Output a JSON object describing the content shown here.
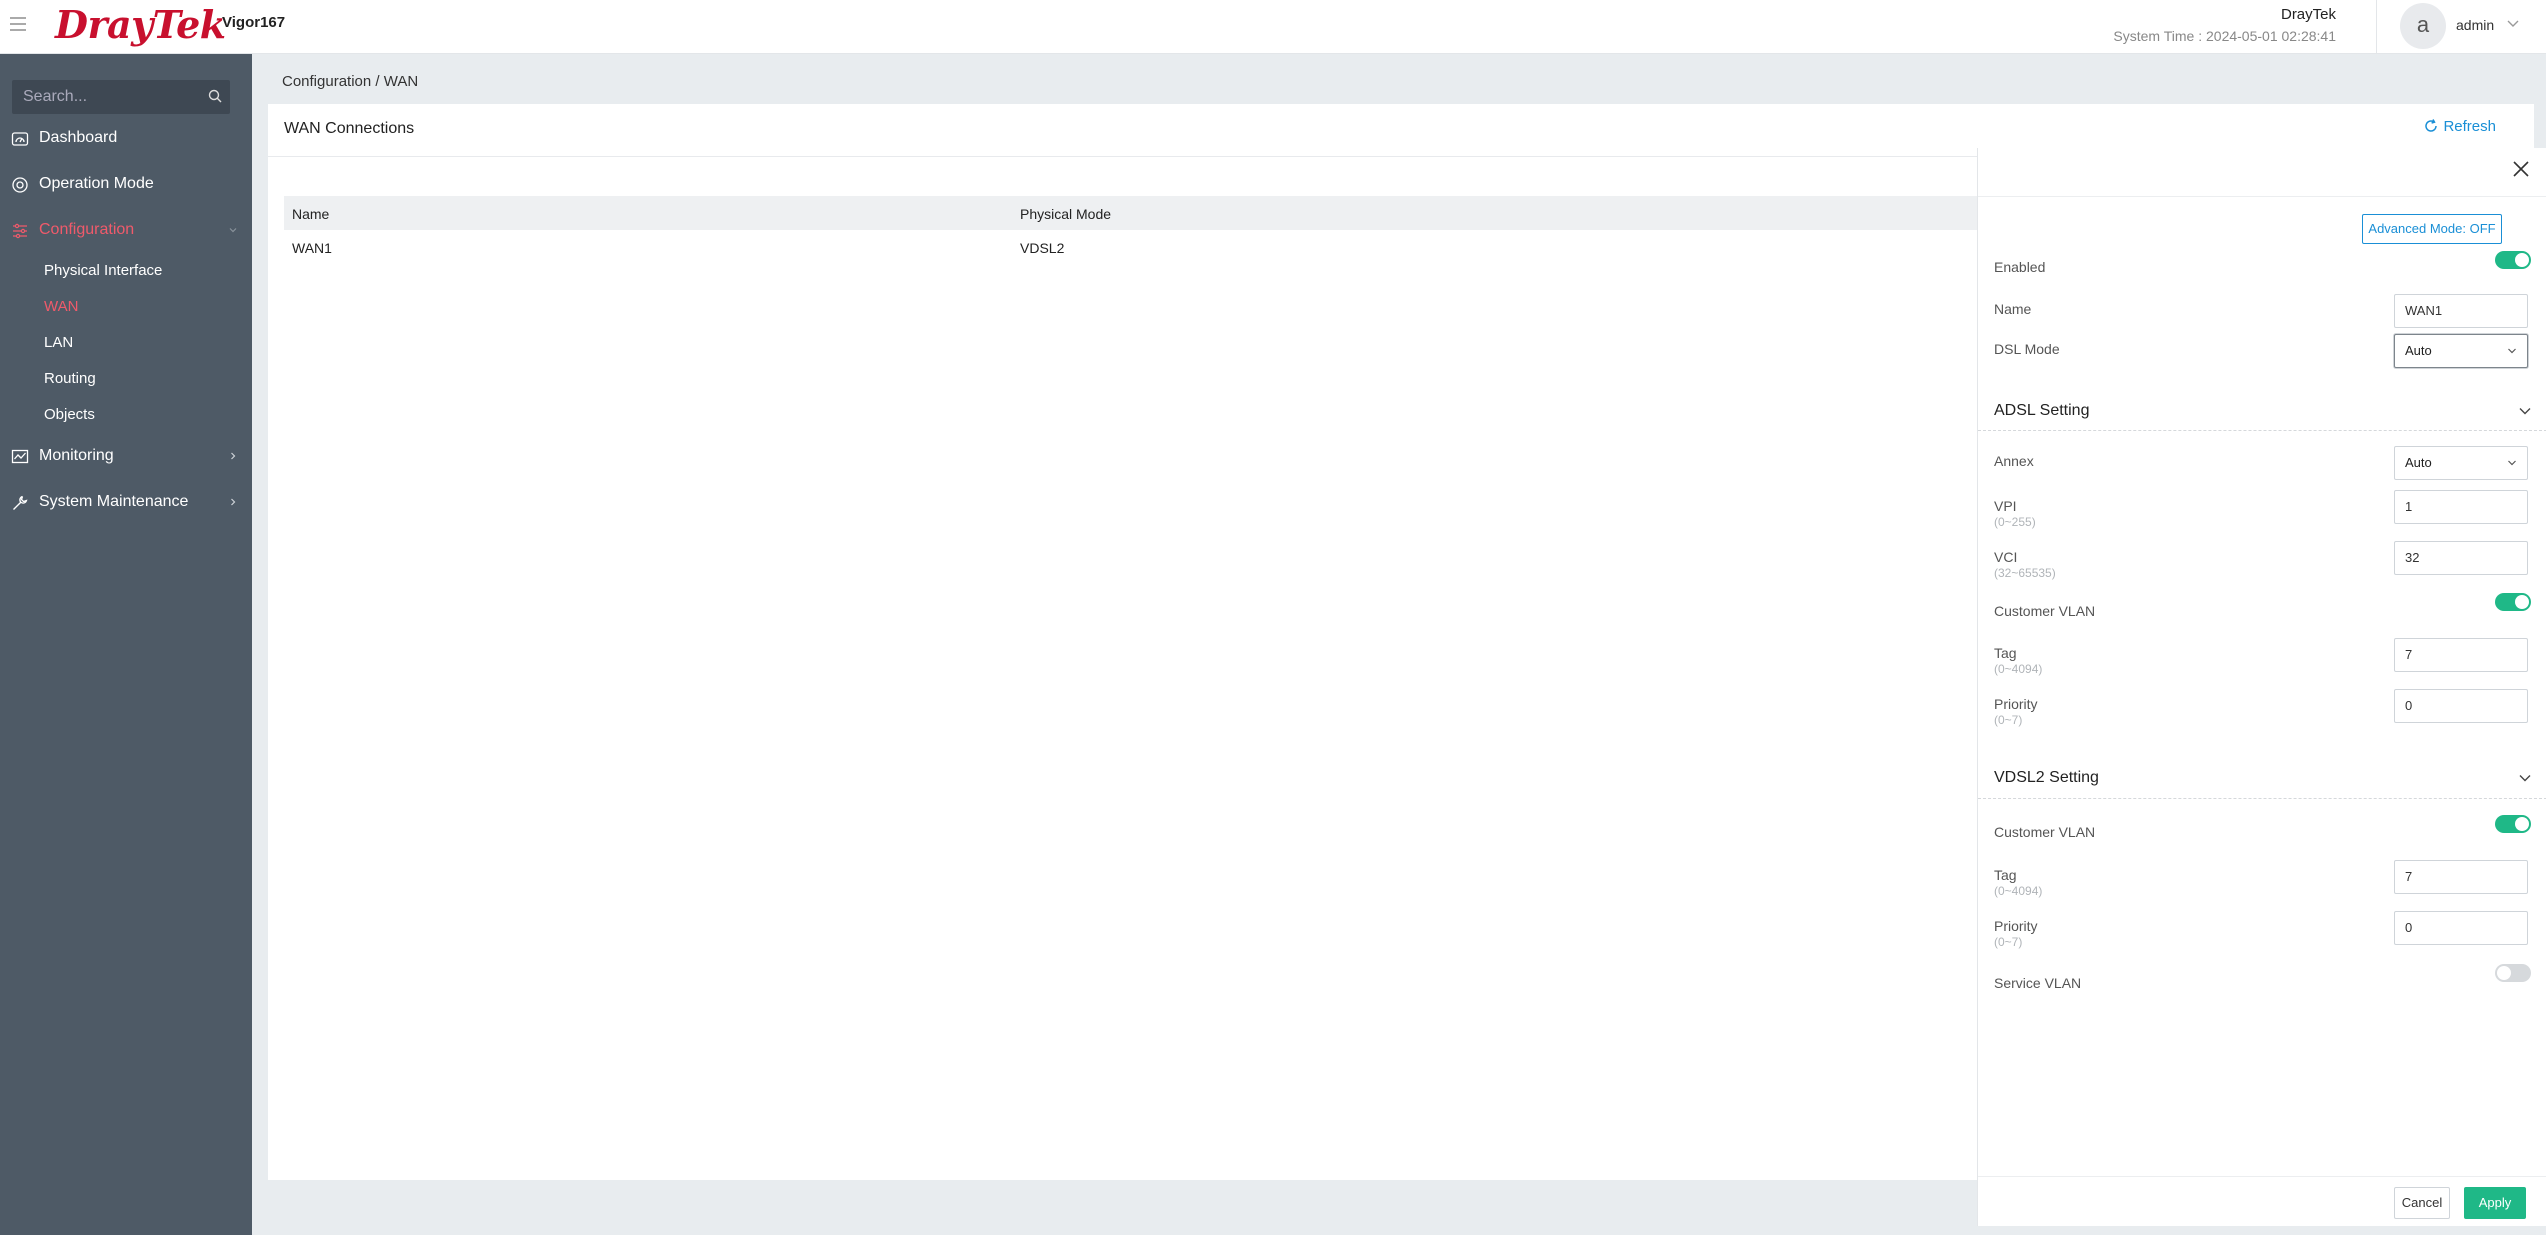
{
  "header": {
    "brand": "DrayTek",
    "model": "Vigor167",
    "company": "DrayTek",
    "system_time": "System Time : 2024-05-01 02:28:41",
    "avatar_letter": "a",
    "username": "admin"
  },
  "sidebar": {
    "search_placeholder": "Search...",
    "items": [
      {
        "label": "Dashboard",
        "icon": "dashboard-icon"
      },
      {
        "label": "Operation Mode",
        "icon": "operation-mode-icon"
      },
      {
        "label": "Configuration",
        "icon": "configuration-icon"
      },
      {
        "label": "Monitoring",
        "icon": "monitoring-icon"
      },
      {
        "label": "System Maintenance",
        "icon": "wrench-icon"
      }
    ],
    "sub_items": [
      "Physical Interface",
      "WAN",
      "LAN",
      "Routing",
      "Objects"
    ]
  },
  "breadcrumb": "Configuration / WAN",
  "card": {
    "title": "WAN Connections",
    "refresh": "Refresh",
    "columns": [
      "Name",
      "Physical Mode"
    ],
    "rows": [
      {
        "name": "WAN1",
        "mode": "VDSL2"
      }
    ]
  },
  "panel": {
    "advanced_mode": "Advanced Mode: OFF",
    "enabled_label": "Enabled",
    "name_label": "Name",
    "name_value": "WAN1",
    "dsl_mode_label": "DSL Mode",
    "dsl_mode_value": "Auto",
    "adsl": {
      "title": "ADSL Setting",
      "annex_label": "Annex",
      "annex_value": "Auto",
      "vpi_label": "VPI",
      "vpi_hint": "(0~255)",
      "vpi_value": "1",
      "vci_label": "VCI",
      "vci_hint": "(32~65535)",
      "vci_value": "32",
      "vlan_label": "Customer VLAN",
      "tag_label": "Tag",
      "tag_hint": "(0~4094)",
      "tag_value": "7",
      "priority_label": "Priority",
      "priority_hint": "(0~7)",
      "priority_value": "0"
    },
    "vdsl2": {
      "title": "VDSL2 Setting",
      "vlan_label": "Customer VLAN",
      "tag_label": "Tag",
      "tag_hint": "(0~4094)",
      "tag_value": "7",
      "priority_label": "Priority",
      "priority_hint": "(0~7)",
      "priority_value": "0",
      "service_vlan_label": "Service VLAN"
    },
    "cancel": "Cancel",
    "apply": "Apply"
  }
}
